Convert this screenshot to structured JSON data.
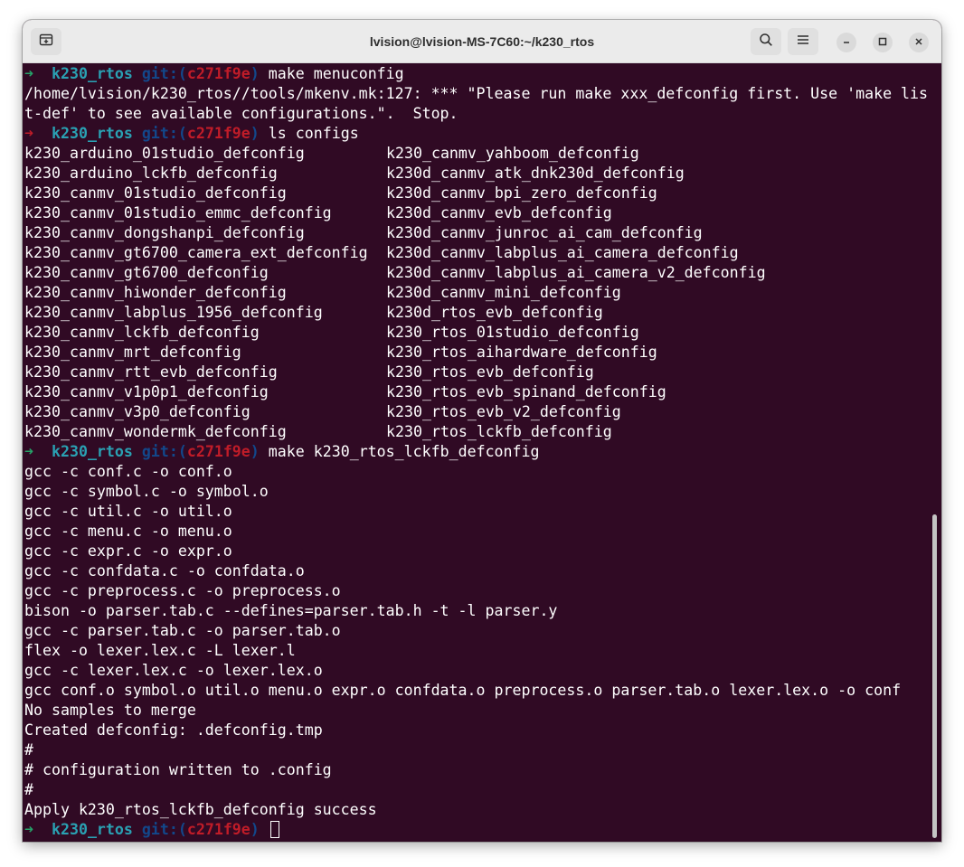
{
  "window": {
    "title": "lvision@lvision-MS-7C60:~/k230_rtos"
  },
  "icons": {
    "new_tab": "new-tab-icon",
    "search": "search-icon",
    "menu": "hamburger-menu-icon",
    "minimize": "minimize-icon",
    "maximize": "maximize-icon",
    "close": "close-icon"
  },
  "colors": {
    "terminal_bg": "#300a24",
    "prompt_ok": "#26a269",
    "prompt_err": "#c01c28",
    "dir": "#2aa1b3",
    "git": "#12488b",
    "branch": "#c01c28"
  },
  "prompt": {
    "arrow": "➜",
    "dir": "k230_rtos",
    "git_open": "git:(",
    "branch": "c271f9e",
    "git_close": ")"
  },
  "commands": {
    "c1": "make menuconfig",
    "c2": "ls configs",
    "c3": "make k230_rtos_lckfb_defconfig"
  },
  "output1": [
    "/home/lvision/k230_rtos//tools/mkenv.mk:127: *** \"Please run make xxx_defconfig first. Use 'make lis",
    "t-def' to see available configurations.\".  Stop."
  ],
  "configs": [
    {
      "left": "k230_arduino_01studio_defconfig",
      "right": "k230_canmv_yahboom_defconfig"
    },
    {
      "left": "k230_arduino_lckfb_defconfig",
      "right": "k230d_canmv_atk_dnk230d_defconfig"
    },
    {
      "left": "k230_canmv_01studio_defconfig",
      "right": "k230d_canmv_bpi_zero_defconfig"
    },
    {
      "left": "k230_canmv_01studio_emmc_defconfig",
      "right": "k230d_canmv_evb_defconfig"
    },
    {
      "left": "k230_canmv_dongshanpi_defconfig",
      "right": "k230d_canmv_junroc_ai_cam_defconfig"
    },
    {
      "left": "k230_canmv_gt6700_camera_ext_defconfig",
      "right": "k230d_canmv_labplus_ai_camera_defconfig"
    },
    {
      "left": "k230_canmv_gt6700_defconfig",
      "right": "k230d_canmv_labplus_ai_camera_v2_defconfig"
    },
    {
      "left": "k230_canmv_hiwonder_defconfig",
      "right": "k230d_canmv_mini_defconfig"
    },
    {
      "left": "k230_canmv_labplus_1956_defconfig",
      "right": "k230d_rtos_evb_defconfig"
    },
    {
      "left": "k230_canmv_lckfb_defconfig",
      "right": "k230_rtos_01studio_defconfig"
    },
    {
      "left": "k230_canmv_mrt_defconfig",
      "right": "k230_rtos_aihardware_defconfig"
    },
    {
      "left": "k230_canmv_rtt_evb_defconfig",
      "right": "k230_rtos_evb_defconfig"
    },
    {
      "left": "k230_canmv_v1p0p1_defconfig",
      "right": "k230_rtos_evb_spinand_defconfig"
    },
    {
      "left": "k230_canmv_v3p0_defconfig",
      "right": "k230_rtos_evb_v2_defconfig"
    },
    {
      "left": "k230_canmv_wondermk_defconfig",
      "right": "k230_rtos_lckfb_defconfig"
    }
  ],
  "output3": [
    "gcc -c conf.c -o conf.o",
    "gcc -c symbol.c -o symbol.o",
    "gcc -c util.c -o util.o",
    "gcc -c menu.c -o menu.o",
    "gcc -c expr.c -o expr.o",
    "gcc -c confdata.c -o confdata.o",
    "gcc -c preprocess.c -o preprocess.o",
    "bison -o parser.tab.c --defines=parser.tab.h -t -l parser.y",
    "gcc -c parser.tab.c -o parser.tab.o",
    "flex -o lexer.lex.c -L lexer.l",
    "gcc -c lexer.lex.c -o lexer.lex.o",
    "gcc conf.o symbol.o util.o menu.o expr.o confdata.o preprocess.o parser.tab.o lexer.lex.o -o conf",
    "No samples to merge",
    "Created defconfig: .defconfig.tmp",
    "#",
    "# configuration written to .config",
    "#",
    "Apply k230_rtos_lckfb_defconfig success"
  ]
}
